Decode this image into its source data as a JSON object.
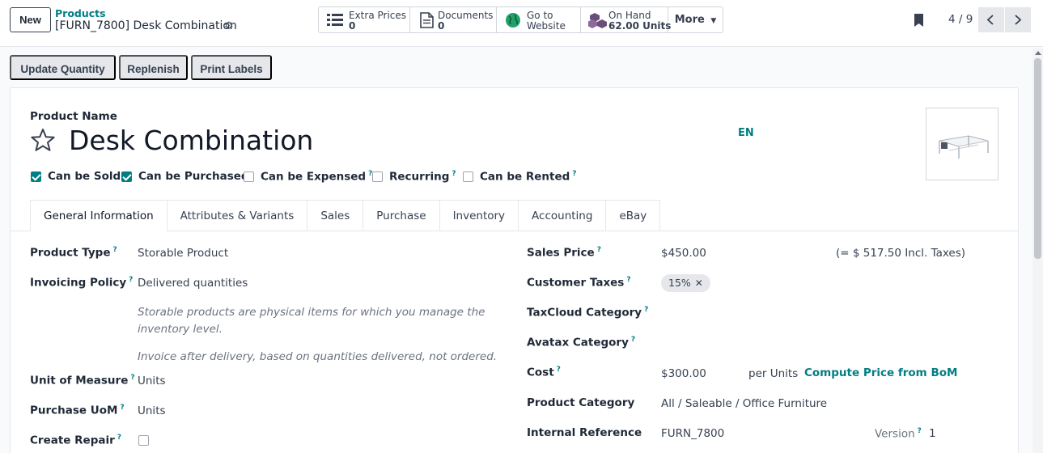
{
  "control_panel": {
    "new_label": "New",
    "breadcrumb": "Products",
    "record_title": "[FURN_7800] Desk Combination",
    "smart_buttons": {
      "extra_prices": {
        "label": "Extra Prices",
        "value": "0"
      },
      "documents": {
        "label": "Documents",
        "value": "0"
      },
      "website": {
        "line1": "Go to",
        "line2": "Website"
      },
      "on_hand": {
        "label": "On Hand",
        "value": "62.00 Units"
      },
      "more": "More"
    },
    "pager": "4 / 9"
  },
  "actions": {
    "update_quantity": "Update Quantity",
    "replenish": "Replenish",
    "print_labels": "Print Labels"
  },
  "form": {
    "product_name_label": "Product Name",
    "product_name": "Desk Combination",
    "language": "EN",
    "checkboxes": {
      "can_be_sold": "Can be Sold",
      "can_be_purchased": "Can be Purchased",
      "can_be_expensed": "Can be Expensed",
      "recurring": "Recurring",
      "can_be_rented": "Can be Rented"
    },
    "tabs": {
      "general": "General Information",
      "attributes": "Attributes & Variants",
      "sales": "Sales",
      "purchase": "Purchase",
      "inventory": "Inventory",
      "accounting": "Accounting",
      "ebay": "eBay"
    },
    "left": {
      "product_type_label": "Product Type",
      "product_type": "Storable Product",
      "invoicing_policy_label": "Invoicing Policy",
      "invoicing_policy": "Delivered quantities",
      "help_storable": "Storable products are physical items for which you manage the inventory level.",
      "help_invoice": "Invoice after delivery, based on quantities delivered, not ordered.",
      "uom_label": "Unit of Measure",
      "uom": "Units",
      "purchase_uom_label": "Purchase UoM",
      "purchase_uom": "Units",
      "create_repair_label": "Create Repair"
    },
    "right": {
      "sales_price_label": "Sales Price",
      "sales_price": "$450.00",
      "incl_taxes": "(= $ 517.50 Incl. Taxes)",
      "customer_taxes_label": "Customer Taxes",
      "customer_tax_tag": "15%",
      "taxcloud_label": "TaxCloud Category",
      "avatax_label": "Avatax Category",
      "cost_label": "Cost",
      "cost": "$300.00",
      "per_units": "per Units",
      "compute_bom": "Compute Price from BoM",
      "product_category_label": "Product Category",
      "product_category": "All / Saleable / Office Furniture",
      "internal_reference_label": "Internal Reference",
      "internal_reference": "FURN_7800",
      "version_label": "Version",
      "version": "1"
    },
    "help_mark": "?"
  },
  "colors": {
    "accent": "#017e84",
    "checkbox_on": "#017e84",
    "button_gray": "#e5e7eb"
  }
}
